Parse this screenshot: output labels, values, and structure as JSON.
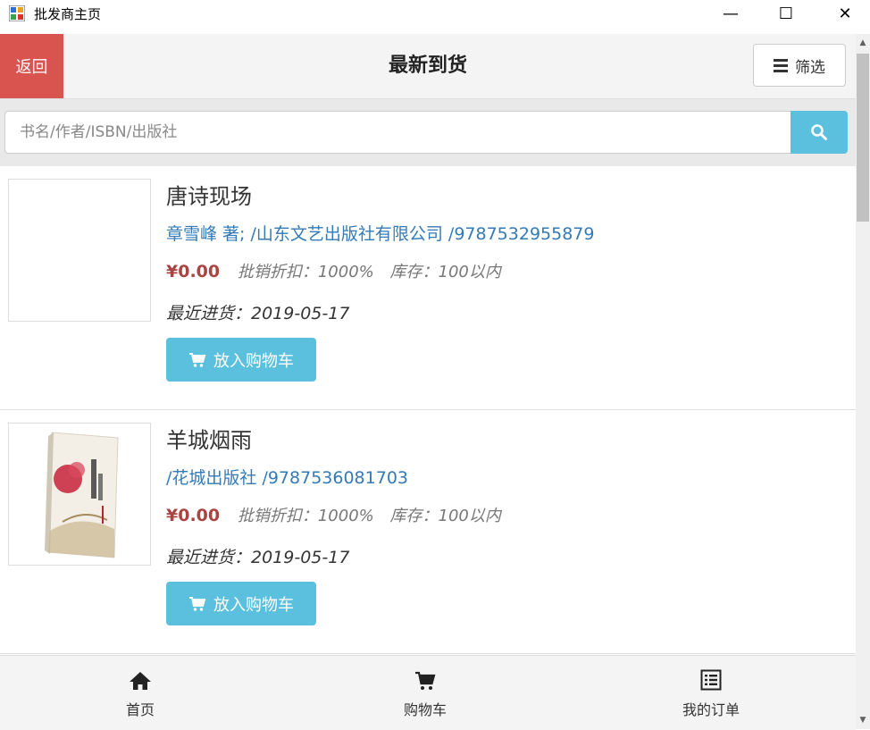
{
  "window": {
    "title": "批发商主页",
    "minimize": "—",
    "maximize": "☐",
    "close": "✕"
  },
  "header": {
    "back_label": "返回",
    "title": "最新到货",
    "filter_label": "筛选"
  },
  "search": {
    "placeholder": "书名/作者/ISBN/出版社",
    "value": ""
  },
  "books": [
    {
      "title": "唐诗现场",
      "meta": "章雪峰 著; /山东文艺出版社有限公司 /9787532955879",
      "price": "¥0.00",
      "discount": "批销折扣：1000%",
      "stock": "库存：100以内",
      "recent": "最近进货：2019-05-17",
      "cart_label": "放入购物车"
    },
    {
      "title": "羊城烟雨",
      "meta": "/花城出版社 /9787536081703",
      "price": "¥0.00",
      "discount": "批销折扣：1000%",
      "stock": "库存：100以内",
      "recent": "最近进货：2019-05-17",
      "cart_label": "放入购物车"
    }
  ],
  "nav": {
    "home": "首页",
    "cart": "购物车",
    "orders": "我的订单"
  },
  "colors": {
    "accent": "#5bc0de",
    "danger": "#d9534f",
    "link": "#337ab7",
    "price": "#a94442"
  },
  "icons": {
    "app": "app-window-icon",
    "filter": "bars-icon",
    "search": "search-icon",
    "cart": "cart-icon",
    "home": "home-icon",
    "orders": "list-icon"
  }
}
